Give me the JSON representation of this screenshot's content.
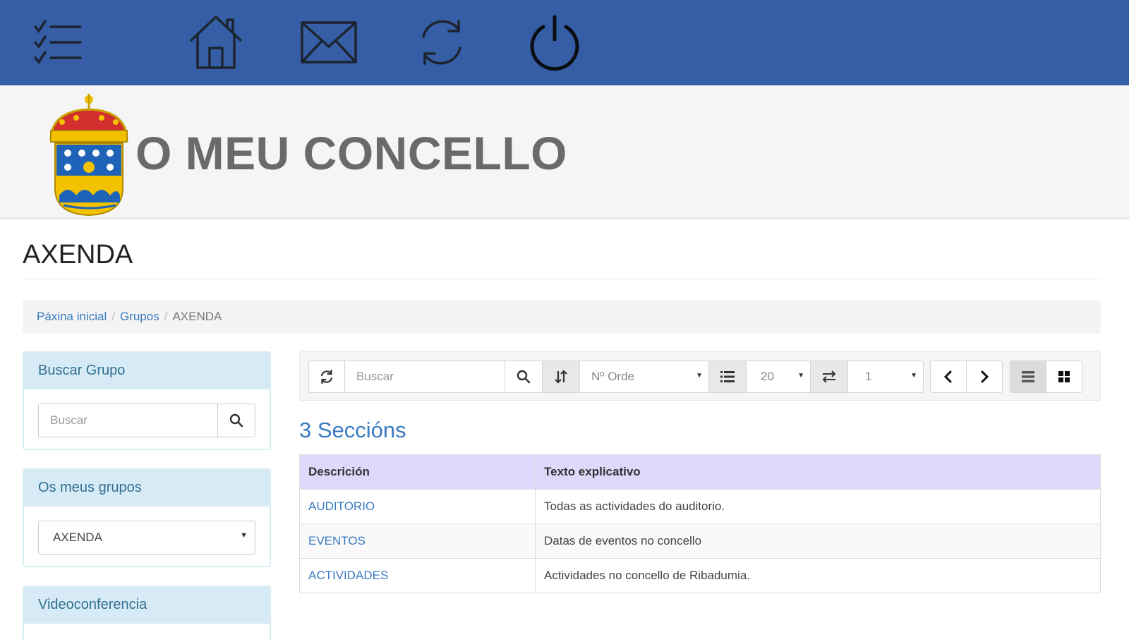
{
  "nav": {
    "icons": [
      "checklist-menu-icon",
      "home-icon",
      "mail-icon",
      "refresh-icon",
      "power-icon"
    ]
  },
  "header": {
    "site_title": "O MEU CONCELLO"
  },
  "page": {
    "title": "AXENDA"
  },
  "breadcrumb": {
    "home": "Páxina inicial",
    "groups": "Grupos",
    "current": "AXENDA"
  },
  "sidebar": {
    "search_panel": {
      "title": "Buscar Grupo",
      "placeholder": "Buscar"
    },
    "groups_panel": {
      "title": "Os meus grupos",
      "selected": "AXENDA"
    },
    "video_panel": {
      "title": "Videoconferencia"
    }
  },
  "toolbar": {
    "search_placeholder": "Buscar",
    "sort_field": "Nº Orde",
    "page_size": "20",
    "page_number": "1"
  },
  "sections": {
    "count_label": "3 Seccións",
    "columns": [
      "Descrición",
      "Texto explicativo"
    ],
    "rows": [
      {
        "name": "AUDITORIO",
        "description": "Todas as actividades do auditorio."
      },
      {
        "name": "EVENTOS",
        "description": "Datas de eventos no concello"
      },
      {
        "name": "ACTIVIDADES",
        "description": "Actividades no concello de Ribadumia."
      }
    ]
  },
  "colors": {
    "topbar": "#365ea6",
    "link": "#3a7ac0",
    "panel_head": "#d7ebf7",
    "table_head": "#dcd9fb"
  }
}
